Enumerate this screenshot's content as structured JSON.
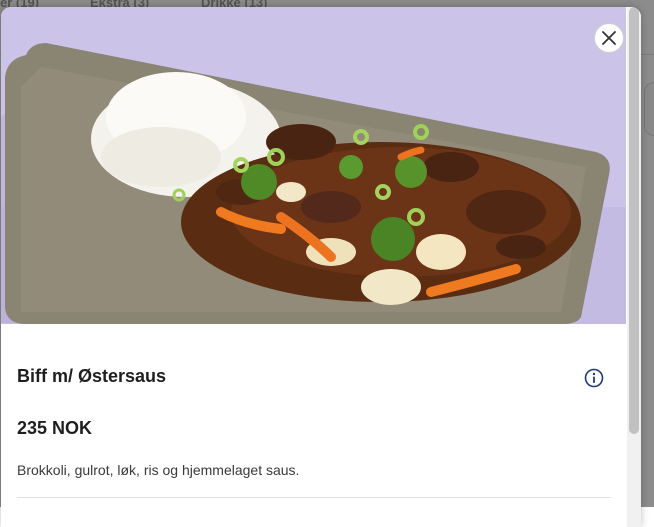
{
  "background_tabs": [
    {
      "label": "er (19)"
    },
    {
      "label": "Ekstra (3)"
    },
    {
      "label": "Drikke (13)"
    }
  ],
  "modal": {
    "image_alt": "Biff m/ Østersaus",
    "close_icon": "close-icon",
    "title": "Biff m/ Østersaus",
    "info_icon": "info-icon",
    "price": "235 NOK",
    "description": "Brokkoli, gulrot, løk, ris og hjemmelaget saus."
  },
  "colors": {
    "image_background": "#cbc3e8",
    "plate": "#8a8473",
    "title_text": "#1f1f1f"
  }
}
